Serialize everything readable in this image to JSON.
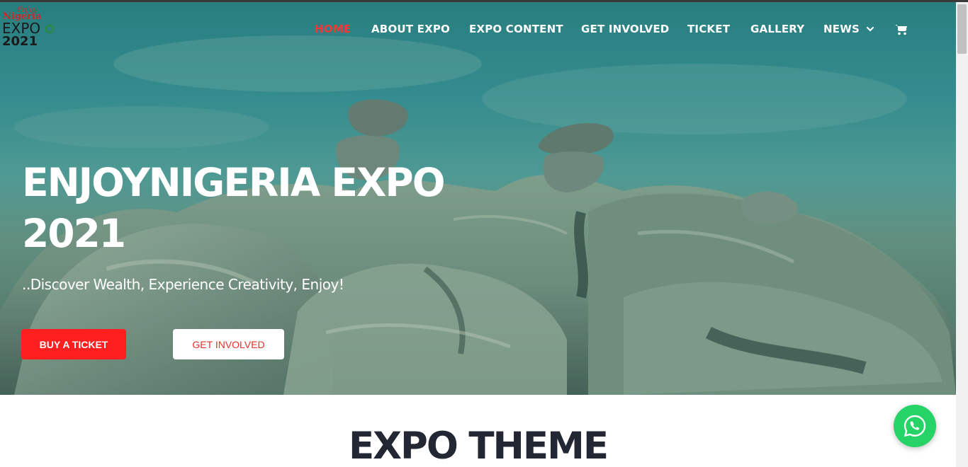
{
  "logo": {
    "line1": "Enjoy",
    "line2": "Nigeria",
    "line3": "EXPO",
    "line4": "2021"
  },
  "nav": {
    "items": [
      {
        "label": "HOME",
        "active": true
      },
      {
        "label": "ABOUT EXPO",
        "active": false
      },
      {
        "label": "EXPO CONTENT",
        "active": false
      },
      {
        "label": "GET INVOLVED",
        "active": false
      },
      {
        "label": "TICKET",
        "active": false
      },
      {
        "label": "GALLERY",
        "active": false
      },
      {
        "label": "NEWS",
        "active": false,
        "has_dropdown": true
      }
    ],
    "cart_icon": "shopping-cart-icon",
    "active_color": "#ee3a33"
  },
  "hero": {
    "title_line1": "ENJOYNIGERIA EXPO",
    "title_line2": "2021",
    "subtitle": "..Discover Wealth, Experience Creativity, Enjoy!",
    "buy_button": "BUY A TICKET",
    "involved_button": "GET INVOLVED"
  },
  "section": {
    "title": "EXPO THEME"
  },
  "colors": {
    "accent_red": "#ff1f1f",
    "whatsapp_green": "#25d366",
    "heading_dark": "#222733"
  },
  "floating": {
    "icon": "whatsapp-icon"
  }
}
